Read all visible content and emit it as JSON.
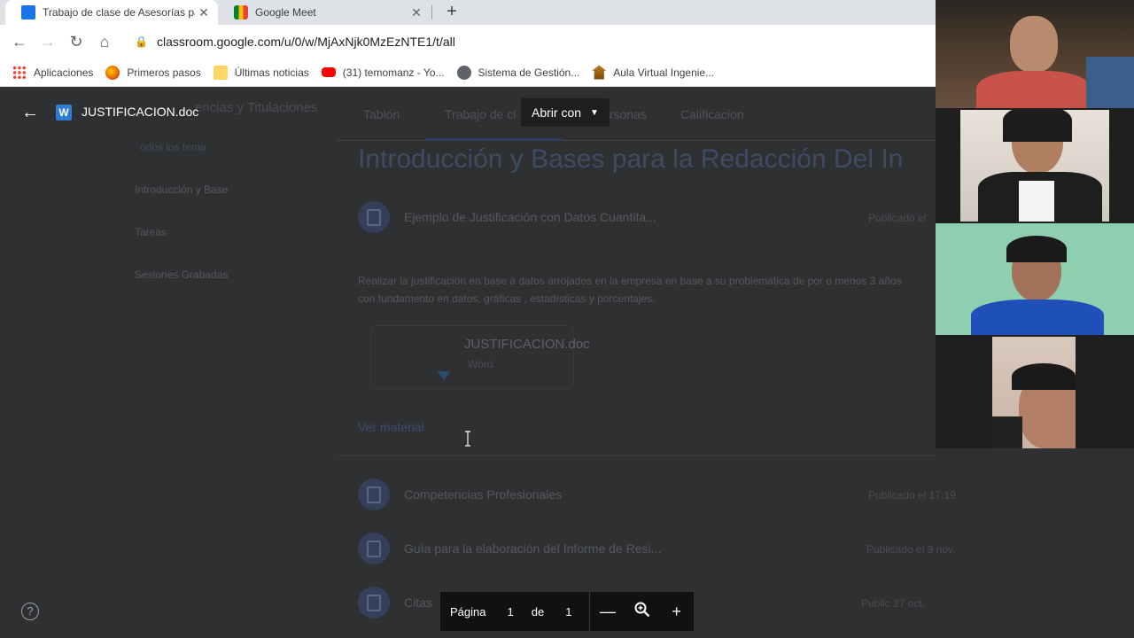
{
  "browser": {
    "tabs": [
      {
        "title": "Trabajo de clase de Asesorías pa",
        "active": true,
        "icon": "classroom-icon"
      },
      {
        "title": "Google Meet",
        "active": false,
        "icon": "meet-icon"
      }
    ],
    "url": "classroom.google.com/u/0/w/MjAxNjk0MzEzNTE1/t/all",
    "bookmarks": [
      {
        "label": "Aplicaciones",
        "icon": "apps-grid-icon"
      },
      {
        "label": "Primeros pasos",
        "icon": "firefox-icon"
      },
      {
        "label": "Últimas noticias",
        "icon": "folder-icon"
      },
      {
        "label": "(31) temomanz - Yo...",
        "icon": "youtube-icon"
      },
      {
        "label": "Sistema de Gestión...",
        "icon": "globe-icon"
      },
      {
        "label": "Aula Virtual Ingenie...",
        "icon": "university-icon"
      }
    ]
  },
  "viewer": {
    "doc_name": "JUSTIFICACION.doc",
    "open_with": "Abrir con",
    "pager": {
      "page_label": "Página",
      "current": "1",
      "of_label": "de",
      "total": "1"
    }
  },
  "classroom": {
    "header_fragment": "encias y Titulaciones",
    "sidebar": {
      "items": [
        "odos los tema",
        "Introducción y Base",
        "Tareas",
        "Sesiones Grabadas"
      ]
    },
    "tabs": [
      "Tablón",
      "Trabajo de cl",
      "ersonas",
      "Calificacion"
    ],
    "topic_title": "Introducción y Bases para la Redacción Del In",
    "cards": [
      {
        "title": "Ejemplo de Justificación con Datos Cuantita...",
        "date": "Publicado el"
      },
      {
        "title": "Competencias Profesionales",
        "date": "Publicado el 17:19"
      },
      {
        "title": "Guía para la elaboración del Informe de Resi...",
        "date": "Publicado el 9 nov."
      },
      {
        "title": "Citas",
        "date": "Public      27 oct."
      }
    ],
    "description_line1": "Realizar la justificación en base a datos arrojados en la empresa en base a su problemática de por o menos 3 años",
    "description_line2": "con fundamento en datos, gráficas , estadísticas y porcentajes.",
    "attachment": {
      "name": "JUSTIFICACION.doc",
      "type": "Word"
    },
    "view_material": "Ver material"
  },
  "colors": {
    "accent": "#1a73e8",
    "word_blue": "#2b7cd3"
  }
}
